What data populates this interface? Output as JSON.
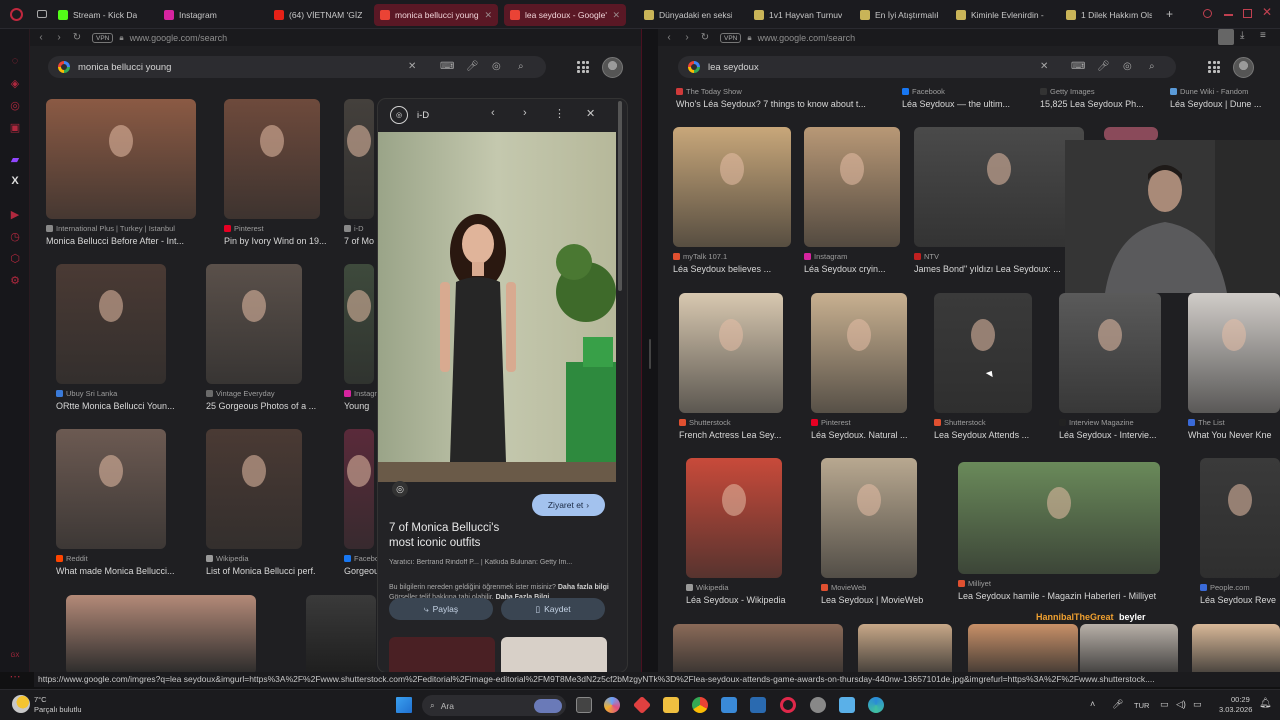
{
  "tabs": [
    {
      "label": "Stream - Kick Da",
      "color": "#53fc18"
    },
    {
      "label": "Instagram",
      "color": "#d6249f"
    },
    {
      "label": "(64) VİETNAM 'GİZL",
      "color": "#e62117"
    },
    {
      "label": "monica bellucci young - G",
      "color": "#ea4335"
    },
    {
      "label": "lea seydoux - Google'da A",
      "color": "#ea4335"
    },
    {
      "label": "Dünyadaki en seksi",
      "color": "#c9b458"
    },
    {
      "label": "1v1 Hayvan Turnuva",
      "color": "#c9b458"
    },
    {
      "label": "En İyi Atıştırmalık (2",
      "color": "#c9b458"
    },
    {
      "label": "Kiminle Evlenirdin -",
      "color": "#c9b458"
    },
    {
      "label": "1 Dilek Hakkım Olsa",
      "color": "#c9b458"
    }
  ],
  "left": {
    "url": "www.google.com/search",
    "query": "monica bellucci young",
    "vpn": "VPN",
    "results": [
      {
        "src": "International Plus | Turkey | Istanbul",
        "title": "Monica Bellucci Before After - Int...",
        "c": "#8b5a44"
      },
      {
        "src": "Pinterest",
        "title": "Pin by Ivory Wind on 19...",
        "c": "#6e4a3c"
      },
      {
        "src": "i-D",
        "title": "7 of Mo",
        "c": "#44403c"
      },
      {
        "src": "Ubuy Sri Lanka",
        "title": "ORtte Monica Bellucci Youn...",
        "c": "#4a3a34"
      },
      {
        "src": "Vintage Everyday",
        "title": "25 Gorgeous Photos of a ...",
        "c": "#5a504a"
      },
      {
        "src": "Instagra",
        "title": "Young",
        "c": "#3e4a3c"
      },
      {
        "src": "Reddit",
        "title": "What made Monica Bellucci...",
        "c": "#6c5a52"
      },
      {
        "src": "Wikipedia",
        "title": "List of Monica Bellucci perf...",
        "c": "#4a3a34"
      },
      {
        "src": "Facebo",
        "title": "Gorgeou",
        "c": "#5a2a3a"
      }
    ]
  },
  "preview": {
    "source": "i-D",
    "title": "7 of Monica Bellucci's most iconic outfits",
    "visit": "Ziyaret et",
    "credit": "Yaratıcı: Bertrand Rindoff P... | Katkıda Bulunan: Getty Im...",
    "notice": "Bu bilgilerin nereden geldiğini öğrenmek ister misiniz?",
    "notice_link": "Daha fazla bilgi",
    "license": "Görseller telif hakkına tabi olabilir.",
    "license_link": "Daha Fazla Bilgi",
    "share": "Paylaş",
    "save": "Kaydet"
  },
  "right": {
    "url": "www.google.com/search",
    "query": "lea seydoux",
    "vpn": "VPN",
    "top_sources": [
      {
        "src": "The Today Show",
        "title": "Who's Léa Seydoux? 7 things to know about t..."
      },
      {
        "src": "Facebook",
        "title": "Léa Seydoux — the ultim..."
      },
      {
        "src": "Getty Images",
        "title": "15,825 Lea Seydoux Ph..."
      },
      {
        "src": "Dune Wiki - Fandom",
        "title": "Léa Seydoux | Dune ..."
      }
    ],
    "row1": [
      {
        "src": "myTalk 107.1",
        "title": "Léa Seydoux believes ...",
        "c": "#c8a77a"
      },
      {
        "src": "Instagram",
        "title": "Léa Seydoux cryin...",
        "c": "#b89876"
      },
      {
        "src": "NTV",
        "title": "James Bond\" yıldızı Lea Seydoux: ...",
        "c": "#4a4a4a"
      }
    ],
    "row2": [
      {
        "src": "Shutterstock",
        "title": "French Actress Lea Sey...",
        "c": "#d8c8b0"
      },
      {
        "src": "Pinterest",
        "title": "Léa Seydoux. Natural ...",
        "c": "#c8b090"
      },
      {
        "src": "Shutterstock",
        "title": "Lea Seydoux Attends ...",
        "c": "#3a3a3a"
      },
      {
        "src": "Interview Magazine",
        "title": "Léa Seydoux - Intervie...",
        "c": "#5a5a5a"
      },
      {
        "src": "The List",
        "title": "What You Never Kne",
        "c": "#d0ccc8"
      }
    ],
    "row3": [
      {
        "src": "Wikipedia",
        "title": "Léa Seydoux - Wikipedia",
        "c": "#c84a3a"
      },
      {
        "src": "MovieWeb",
        "title": "Lea Seydoux | MovieWeb",
        "c": "#b8a890"
      },
      {
        "src": "Milliyet",
        "title": "Lea Seydoux hamile - Magazin Haberleri - Milliyet",
        "c": "#6a8a5a"
      },
      {
        "src": "People.com",
        "title": "Léa Seydoux Reve",
        "c": "#3a3a3a"
      }
    ]
  },
  "chat": {
    "user": "HannibalTheGreat",
    "message": "beyler"
  },
  "status_url": "https://www.google.com/imgres?q=lea seydoux&imgurl=https%3A%2F%2Fwww.shutterstock.com%2Feditorial%2Fimage-editorial%2FM9T8Me3dN2z5cf2bMzgyNTk%3D%2Flea-seydoux-attends-game-awards-on-thursday-440nw-13657101de.jpg&imgrefurl=https%3A%2F%2Fwww.shutterstock....",
  "taskbar": {
    "weather_temp": "7°C",
    "weather_desc": "Parçalı bulutlu",
    "search": "Ara",
    "lang": "TUR",
    "time": "00:29",
    "date": "3.03.2026"
  },
  "colors": {
    "accent": "#b0283e",
    "active_tab": "#5a1825",
    "chat_name": "#f0a030"
  }
}
